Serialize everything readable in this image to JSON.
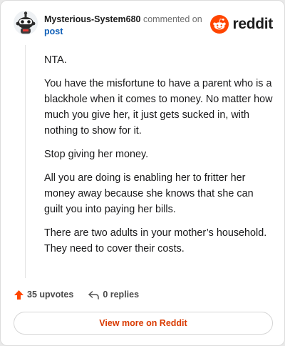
{
  "comment": {
    "username": "Mysterious-System680",
    "action_text": "commented on",
    "post_link_label": "post",
    "avatar_icon": "snoo-avatar-icon",
    "paragraphs": [
      "NTA.",
      "You have the misfortune to have a parent who is a blackhole when it comes to money. No matter how much you give her, it just gets sucked in, with nothing to show for it.",
      "Stop giving her money.",
      "All you are doing is enabling her to fritter her money away because she knows that she can guilt you into paying her bills.",
      "There are two adults in your mother’s household. They need to cover their costs."
    ]
  },
  "brand": {
    "name": "reddit",
    "icon": "reddit-logo-icon",
    "color": "#ff4500"
  },
  "actions": {
    "upvotes_label": "35 upvotes",
    "replies_label": "0 replies",
    "upvote_icon": "upvote-arrow-icon",
    "reply_icon": "reply-arrow-icon",
    "upvote_color": "#ff4500"
  },
  "cta": {
    "label": "View more on Reddit",
    "color": "#d93a00"
  }
}
